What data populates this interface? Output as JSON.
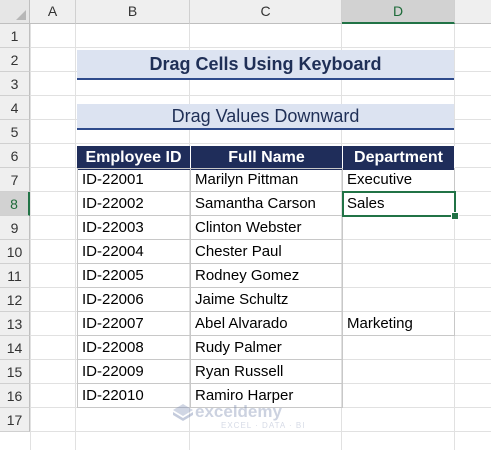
{
  "column_headers": [
    "A",
    "B",
    "C",
    "D"
  ],
  "selected_column": "D",
  "row_headers": [
    "1",
    "2",
    "3",
    "4",
    "5",
    "6",
    "7",
    "8",
    "9",
    "10",
    "11",
    "12",
    "13",
    "14",
    "15",
    "16",
    "17"
  ],
  "selected_row": "8",
  "title": "Drag Cells Using Keyboard",
  "subtitle": "Drag Values Downward",
  "table": {
    "headers": [
      "Employee ID",
      "Full Name",
      "Department"
    ],
    "rows": [
      [
        "ID-22001",
        "Marilyn Pittman",
        "Executive"
      ],
      [
        "ID-22002",
        "Samantha Carson",
        "Sales"
      ],
      [
        "ID-22003",
        "Clinton Webster",
        ""
      ],
      [
        "ID-22004",
        "Chester Paul",
        ""
      ],
      [
        "ID-22005",
        "Rodney Gomez",
        ""
      ],
      [
        "ID-22006",
        "Jaime Schultz",
        ""
      ],
      [
        "ID-22007",
        "Abel Alvarado",
        "Marketing"
      ],
      [
        "ID-22008",
        "Rudy Palmer",
        ""
      ],
      [
        "ID-22009",
        "Ryan Russell",
        ""
      ],
      [
        "ID-22010",
        "Ramiro Harper",
        ""
      ]
    ]
  },
  "active_cell": "D8",
  "watermark": {
    "logo_text": "exceldemy",
    "tagline": "EXCEL · DATA · BI"
  },
  "colors": {
    "header_fill": "#1f2d5a",
    "banner_fill": "#dce3f1",
    "banner_border": "#2f4b8c",
    "selection": "#217346"
  }
}
